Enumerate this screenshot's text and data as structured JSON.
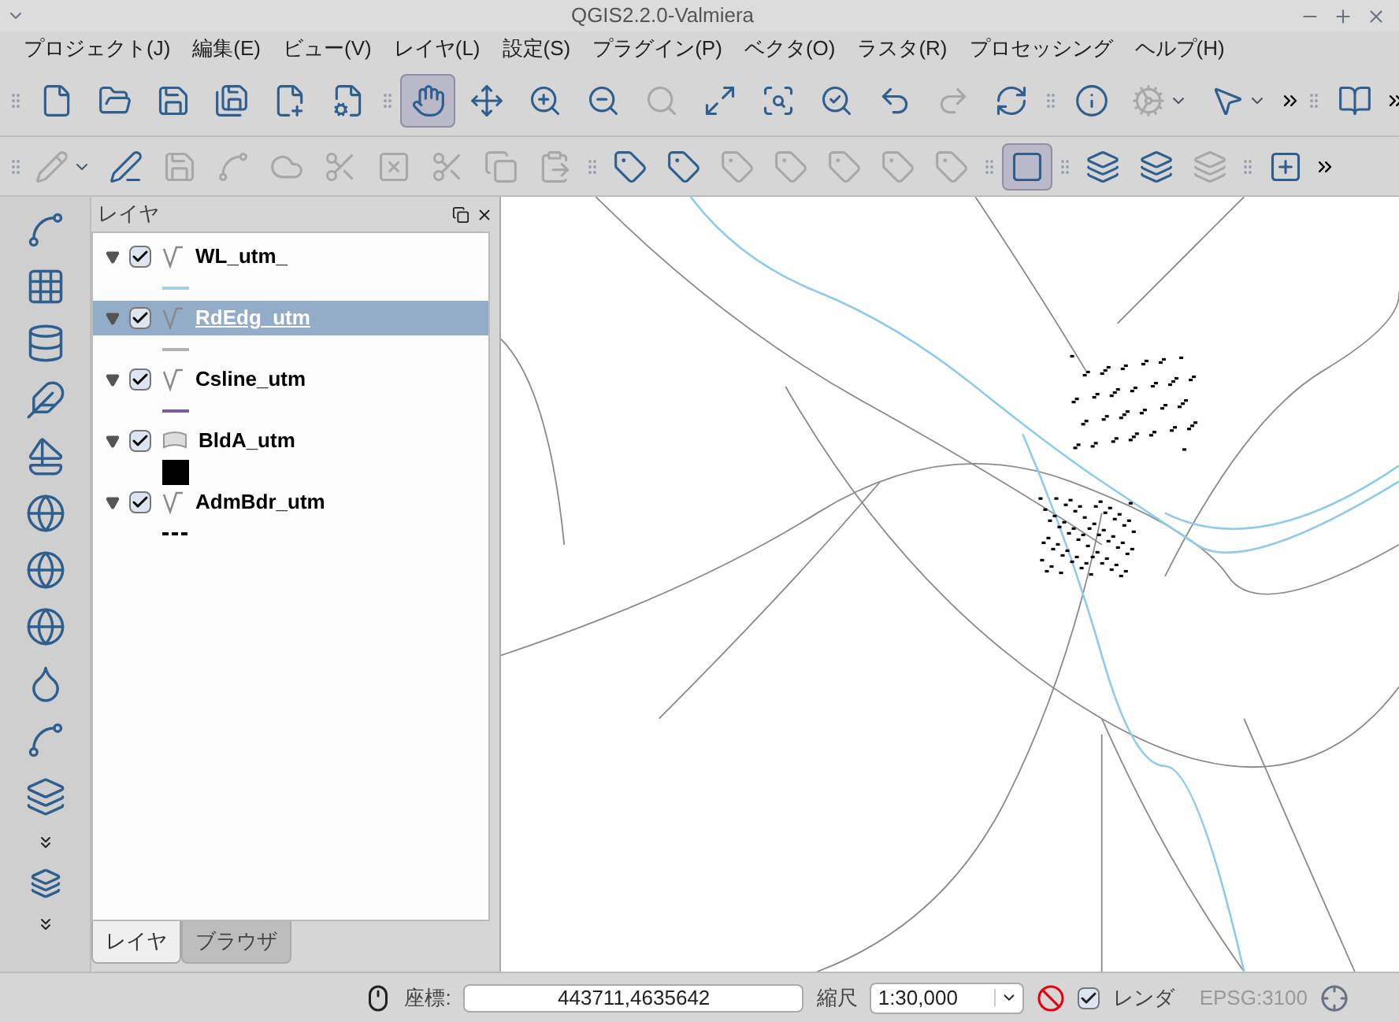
{
  "window": {
    "title": "QGIS2.2.0-Valmiera"
  },
  "menu": [
    "プロジェクト(J)",
    "編集(E)",
    "ビュー(V)",
    "レイヤ(L)",
    "設定(S)",
    "プラグイン(P)",
    "ベクタ(O)",
    "ラスタ(R)",
    "プロセッシング",
    "ヘルプ(H)"
  ],
  "toolbars": [
    {
      "groups": [
        [
          {
            "disabled": false,
            "selected": false,
            "has_menu": false
          },
          {
            "disabled": false,
            "selected": false,
            "has_menu": false
          },
          {
            "disabled": false,
            "selected": false,
            "has_menu": false
          },
          {
            "disabled": false,
            "selected": false,
            "has_menu": false
          },
          {
            "disabled": false,
            "selected": false,
            "has_menu": false
          },
          {
            "disabled": false,
            "selected": false,
            "has_menu": false
          }
        ],
        [
          {
            "disabled": false,
            "selected": true,
            "has_menu": false
          },
          {
            "disabled": false,
            "selected": false,
            "has_menu": false
          },
          {
            "disabled": false,
            "selected": false,
            "has_menu": false
          },
          {
            "disabled": false,
            "selected": false,
            "has_menu": false
          },
          {
            "disabled": true,
            "selected": false,
            "has_menu": false
          },
          {
            "disabled": false,
            "selected": false,
            "has_menu": false
          },
          {
            "disabled": false,
            "selected": false,
            "has_menu": false
          },
          {
            "disabled": false,
            "selected": false,
            "has_menu": false
          },
          {
            "disabled": false,
            "selected": false,
            "has_menu": false
          },
          {
            "disabled": true,
            "selected": false,
            "has_menu": false
          },
          {
            "disabled": false,
            "selected": false,
            "has_menu": false
          }
        ],
        [
          {
            "disabled": false,
            "selected": false,
            "has_menu": false
          },
          {
            "disabled": true,
            "selected": false,
            "has_menu": true
          },
          {
            "disabled": false,
            "selected": false,
            "has_menu": true
          }
        ],
        [
          {
            "disabled": false,
            "selected": false,
            "has_menu": false
          }
        ]
      ]
    },
    {
      "groups": [
        [
          {
            "disabled": true,
            "selected": false,
            "has_menu": true
          },
          {
            "disabled": false,
            "selected": false,
            "has_menu": false
          },
          {
            "disabled": true,
            "selected": false,
            "has_menu": false
          },
          {
            "disabled": true,
            "selected": false,
            "has_menu": false
          },
          {
            "disabled": true,
            "selected": false,
            "has_menu": false
          },
          {
            "disabled": true,
            "selected": false,
            "has_menu": false
          },
          {
            "disabled": true,
            "selected": false,
            "has_menu": false
          },
          {
            "disabled": true,
            "selected": false,
            "has_menu": false
          },
          {
            "disabled": true,
            "selected": false,
            "has_menu": false
          },
          {
            "disabled": true,
            "selected": false,
            "has_menu": false
          }
        ],
        [
          {
            "disabled": false,
            "selected": false,
            "has_menu": false
          },
          {
            "disabled": false,
            "selected": false,
            "has_menu": false
          },
          {
            "disabled": true,
            "selected": false,
            "has_menu": false
          },
          {
            "disabled": true,
            "selected": false,
            "has_menu": false
          },
          {
            "disabled": true,
            "selected": false,
            "has_menu": false
          },
          {
            "disabled": true,
            "selected": false,
            "has_menu": false
          },
          {
            "disabled": true,
            "selected": false,
            "has_menu": false
          }
        ],
        [
          {
            "disabled": false,
            "selected": true,
            "has_menu": false
          }
        ],
        [
          {
            "disabled": false,
            "selected": false,
            "has_menu": false
          },
          {
            "disabled": false,
            "selected": false,
            "has_menu": false
          },
          {
            "disabled": true,
            "selected": false,
            "has_menu": false
          }
        ],
        [
          {
            "disabled": false,
            "selected": false,
            "has_menu": false
          }
        ]
      ]
    }
  ],
  "layers_panel": {
    "title": "レイヤ",
    "layers": [
      {
        "name": "WL_utm_",
        "checked": true,
        "expanded": true,
        "selected": false,
        "kind": "line",
        "legend": {
          "kind": "line",
          "color": "#a6cee3"
        }
      },
      {
        "name": "RdEdg_utm",
        "checked": true,
        "expanded": true,
        "selected": true,
        "kind": "line",
        "legend": {
          "kind": "line",
          "color": "#b4b4b4"
        }
      },
      {
        "name": "Csline_utm",
        "checked": true,
        "expanded": true,
        "selected": false,
        "kind": "line",
        "legend": {
          "kind": "line",
          "color": "#7d5a9a"
        }
      },
      {
        "name": "BldA_utm",
        "checked": true,
        "expanded": true,
        "selected": false,
        "kind": "polygon",
        "legend": {
          "kind": "fill",
          "color": "#000000"
        }
      },
      {
        "name": "AdmBdr_utm",
        "checked": true,
        "expanded": true,
        "selected": false,
        "kind": "line",
        "legend": {
          "kind": "dash",
          "color": "#000000"
        }
      }
    ],
    "tabs": [
      {
        "label": "レイヤ",
        "selected": true
      },
      {
        "label": "ブラウザ",
        "selected": false
      }
    ]
  },
  "status_bar": {
    "coordinate_label": "座標:",
    "coordinate": "443711,4635642",
    "scale_label": "縮尺",
    "scale": "1:30,000",
    "render": {
      "label": "レンダ",
      "checked": true
    },
    "crs": "EPSG:3100"
  }
}
